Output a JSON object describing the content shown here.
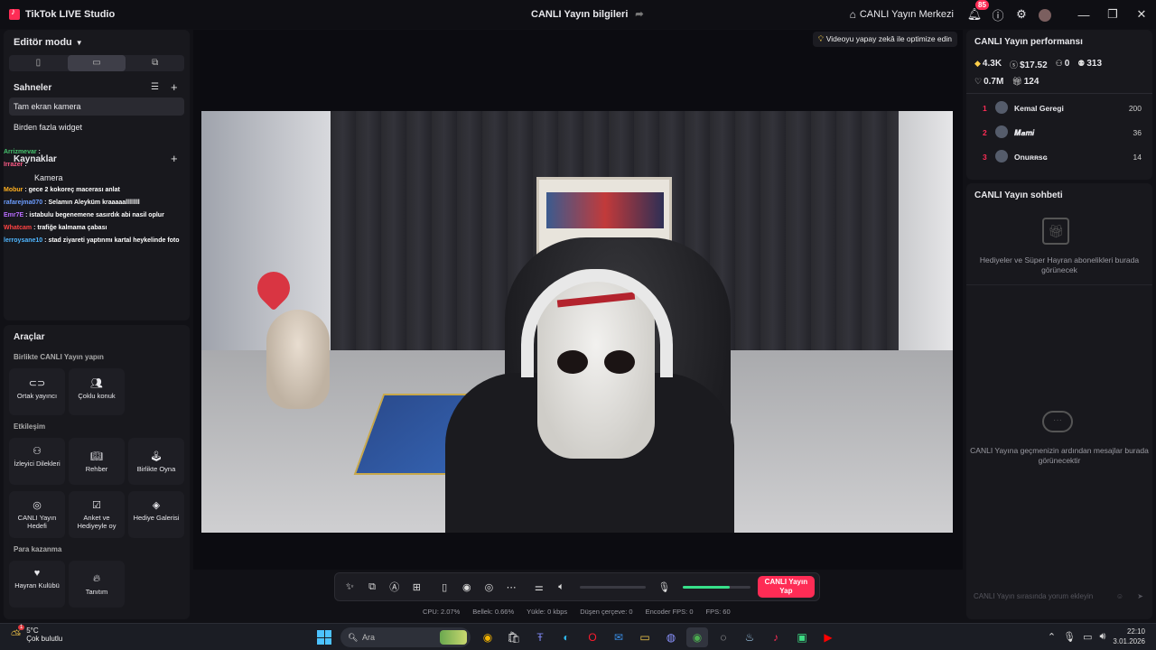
{
  "window": {
    "app_title": "TikTok LIVE Studio",
    "center_title": "CANLI Yayın bilgileri",
    "live_center": "CANLI Yayın Merkezi",
    "notif_count": "85"
  },
  "left": {
    "editor_mode": "Editör modu",
    "scenes_title": "Sahneler",
    "scenes": [
      "Tam ekran kamera",
      "Birden fazla widget"
    ],
    "sources_title": "Kaynaklar",
    "sources": [
      "Kamera"
    ]
  },
  "chat_overlay": [
    {
      "user": "Arrizmevar",
      "text": ""
    },
    {
      "user": "Irrazer",
      "text": ""
    },
    {
      "user": "",
      "text": ""
    },
    {
      "user": "Mobur",
      "text": "gece 2 kokoreç macerası anlat"
    },
    {
      "user": "rafarejma070",
      "text": "Selamın Aleyküm kraaaaallllllll"
    },
    {
      "user": "Emr7E",
      "text": "istabulu begenemene sasırdık abi nasil oplur"
    },
    {
      "user": "Whatcam",
      "text": "trafiğe kalmama çabası"
    },
    {
      "user": "lerroysane10",
      "text": "stad ziyareti yaptınmı kartal heykelinde foto"
    }
  ],
  "tools": {
    "title": "Araçlar",
    "group_collab": "Birlikte CANLI Yayın yapın",
    "group_interaction": "Etkileşim",
    "group_money": "Para kazanma",
    "co_host": "Ortak yayıncı",
    "multi_guest": "Çoklu konuk",
    "viewer_requests": "İzleyici Dilekleri",
    "guide": "Rehber",
    "play_together": "Birlikte Oyna",
    "live_goal": "CANLI Yayın Hedefi",
    "poll": "Anket ve Hediyeyle oy",
    "gift_gallery": "Hediye Galerisi",
    "fan_club": "Hayran Kulübü",
    "promote": "Tanıtım"
  },
  "stage": {
    "tip": "Videoyu yapay zekâ ile optimize edin"
  },
  "controls": {
    "go_live": "CANLI Yayın Yap",
    "mic_level": 0.7,
    "volume_level": 0
  },
  "stats": {
    "cpu": "CPU: 2.07%",
    "memory": "Bellek: 0.66%",
    "upload": "Yükle: 0 kbps",
    "dropped": "Düşen çerçeve: 0",
    "encoder": "Encoder FPS: 0",
    "fps": "FPS: 60"
  },
  "performance": {
    "title": "CANLI Yayın performansı",
    "diamonds": "4.3K",
    "earnings": "$17.52",
    "viewers": "0",
    "followers": "313",
    "likes": "0.7M",
    "gifts": "124",
    "ranking": [
      {
        "pos": "1",
        "name": "Kemal Geregi",
        "score": "200"
      },
      {
        "pos": "2",
        "name": "𝑴𝒂𝒎𝒊",
        "score": "36"
      },
      {
        "pos": "3",
        "name": "Onuʀʀsɢ",
        "score": "14"
      }
    ]
  },
  "chat_panel": {
    "title": "CANLI Yayın sohbeti",
    "gifts_empty": "Hediyeler ve Süper Hayran abonelikleri burada görünecek",
    "messages_empty": "CANLI Yayına geçmenizin ardından mesajlar burada görünecektir",
    "input_placeholder": "CANLI Yayın sırasında yorum ekleyin"
  },
  "taskbar": {
    "temp": "5°C",
    "weather": "Çok bulutlu",
    "weather_badge": "1",
    "search_placeholder": "Ara",
    "time": "22:10",
    "date": "3.01.2026"
  },
  "colors": {
    "accent": "#fe2c55",
    "mic_green": "#37e08a",
    "panel": "#18181d"
  }
}
